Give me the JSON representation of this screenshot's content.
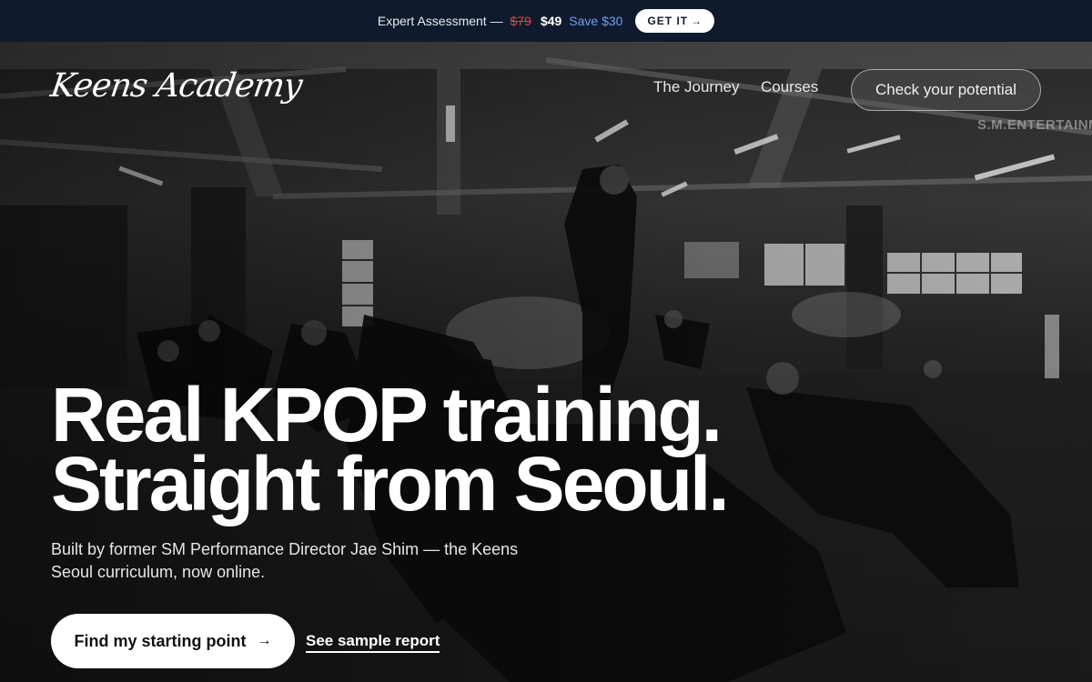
{
  "promo": {
    "label": "Expert Assessment —",
    "old_price": "$79",
    "new_price": "$49",
    "save": "Save $30",
    "cta": "GET IT",
    "cta_icon": "arrow-right-icon"
  },
  "nav": {
    "logo": "Keens Academy",
    "links": [
      "The Journey",
      "Courses"
    ],
    "cta": "Check your potential"
  },
  "hero": {
    "watermark": "S.M.ENTERTAINM",
    "headline": [
      "Real KPOP training.",
      "Straight from Seoul."
    ],
    "subtitle": "Built by former SM Performance Director Jae Shim — the Keens Seoul curriculum, now online.",
    "primary_cta": "Find my starting point",
    "primary_cta_icon": "arrow-right-icon",
    "secondary_cta": "See sample report"
  },
  "colors": {
    "promo_bg": "#0f1a2e",
    "old_price": "#e0404a",
    "save": "#6fa0e8",
    "accent": "#ffffff"
  }
}
